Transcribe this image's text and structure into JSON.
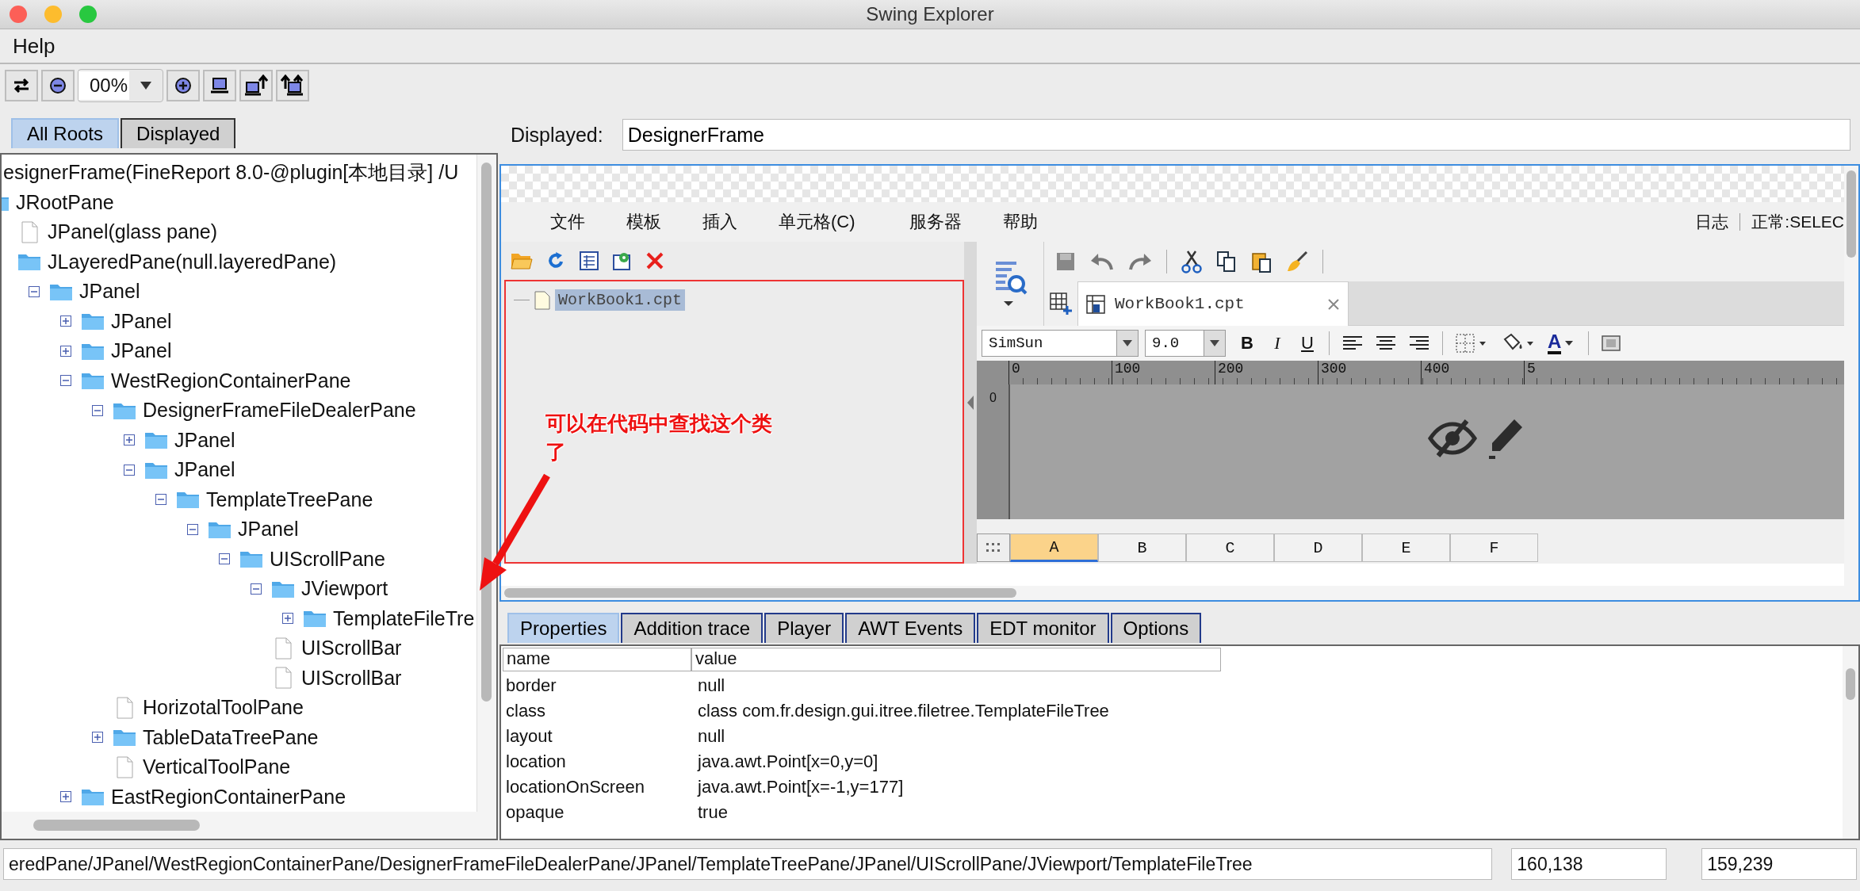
{
  "window": {
    "title": "Swing Explorer"
  },
  "menu": [
    "Help"
  ],
  "toolbar": {
    "zoom": "00%"
  },
  "left_tabs": [
    {
      "label": "All Roots",
      "selected": true
    },
    {
      "label": "Displayed",
      "selected": false
    }
  ],
  "tree": {
    "label": "esignerFrame(FineReport 8.0-@plugin[本地目录]    /U",
    "children": [
      {
        "label": "JRootPane",
        "kind": "folder",
        "children": [
          {
            "label": "JPanel(glass pane)",
            "kind": "file"
          },
          {
            "label": "JLayeredPane(null.layeredPane)",
            "kind": "folder",
            "children": [
              {
                "label": "JPanel",
                "kind": "folder",
                "expanded": true,
                "children": [
                  {
                    "label": "JPanel",
                    "kind": "folder",
                    "expanded": false
                  },
                  {
                    "label": "JPanel",
                    "kind": "folder",
                    "expanded": false
                  },
                  {
                    "label": "WestRegionContainerPane",
                    "kind": "folder",
                    "expanded": true,
                    "children": [
                      {
                        "label": "DesignerFrameFileDealerPane",
                        "kind": "folder",
                        "expanded": true,
                        "children": [
                          {
                            "label": "JPanel",
                            "kind": "folder",
                            "expanded": false
                          },
                          {
                            "label": "JPanel",
                            "kind": "folder",
                            "expanded": true,
                            "children": [
                              {
                                "label": "TemplateTreePane",
                                "kind": "folder",
                                "expanded": true,
                                "children": [
                                  {
                                    "label": "JPanel",
                                    "kind": "folder",
                                    "expanded": true,
                                    "children": [
                                      {
                                        "label": "UIScrollPane",
                                        "kind": "folder",
                                        "expanded": true,
                                        "children": [
                                          {
                                            "label": "JViewport",
                                            "kind": "folder",
                                            "expanded": true,
                                            "children": [
                                              {
                                                "label": "TemplateFileTre",
                                                "kind": "folder",
                                                "expanded": false
                                              }
                                            ]
                                          },
                                          {
                                            "label": "UIScrollBar",
                                            "kind": "file"
                                          },
                                          {
                                            "label": "UIScrollBar",
                                            "kind": "file"
                                          }
                                        ]
                                      }
                                    ]
                                  }
                                ]
                              }
                            ]
                          }
                        ]
                      },
                      {
                        "label": "HorizotalToolPane",
                        "kind": "file"
                      },
                      {
                        "label": "TableDataTreePane",
                        "kind": "folder",
                        "expanded": false
                      },
                      {
                        "label": "VerticalToolPane",
                        "kind": "file"
                      }
                    ]
                  },
                  {
                    "label": "EastRegionContainerPane",
                    "kind": "folder",
                    "expanded": false
                  }
                ]
              }
            ]
          }
        ]
      }
    ]
  },
  "displayed": {
    "label": "Displayed:",
    "value": "DesignerFrame"
  },
  "preview": {
    "menu": [
      "文件",
      "模板",
      "插入",
      "单元格(C)",
      "服务器",
      "帮助"
    ],
    "status": [
      "日志",
      "正常:SELEC"
    ],
    "file_item": {
      "label": "WorkBook1.cpt",
      "selected": true
    },
    "tab": "WorkBook1.cpt",
    "font": "SimSun",
    "size": "9.0",
    "styles": [
      "B",
      "I",
      "U"
    ],
    "font_color": "A",
    "ruler": [
      "0",
      "100",
      "200",
      "300",
      "400",
      "5"
    ],
    "vruler": "0",
    "columns": [
      {
        "label": "A",
        "selected": true
      },
      {
        "label": "B",
        "selected": false
      },
      {
        "label": "C",
        "selected": false
      },
      {
        "label": "D",
        "selected": false
      },
      {
        "label": "E",
        "selected": false
      },
      {
        "label": "F",
        "selected": false
      }
    ]
  },
  "annotation": {
    "text": "可以在代码中查找这个类了"
  },
  "bottom_tabs": [
    {
      "label": "Properties",
      "selected": true
    },
    {
      "label": "Addition trace",
      "selected": false
    },
    {
      "label": "Player",
      "selected": false
    },
    {
      "label": "AWT Events",
      "selected": false
    },
    {
      "label": "EDT monitor",
      "selected": false
    },
    {
      "label": "Options",
      "selected": false
    }
  ],
  "properties": {
    "columns": [
      "name",
      "value"
    ],
    "rows": [
      [
        "border",
        "null"
      ],
      [
        "class",
        "class com.fr.design.gui.itree.filetree.TemplateFileTree"
      ],
      [
        "layout",
        "null"
      ],
      [
        "location",
        "java.awt.Point[x=0,y=0]"
      ],
      [
        "locationOnScreen",
        "java.awt.Point[x=-1,y=177]"
      ],
      [
        "opaque",
        "true"
      ]
    ]
  },
  "status_bar": {
    "path": "eredPane/JPanel/WestRegionContainerPane/DesignerFrameFileDealerPane/JPanel/TemplateTreePane/JPanel/UIScrollPane/JViewport/TemplateFileTree",
    "coord_1": "160,138",
    "coord_2": "159,239"
  }
}
